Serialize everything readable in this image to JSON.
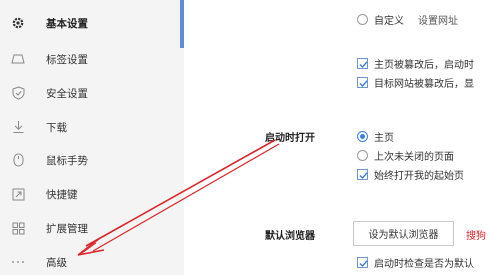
{
  "sidebar": {
    "items": [
      {
        "label": "基本设置",
        "icon": "gear-icon",
        "active": true
      },
      {
        "label": "标签设置",
        "icon": "tab-icon"
      },
      {
        "label": "安全设置",
        "icon": "shield-icon"
      },
      {
        "label": "下载",
        "icon": "download-icon"
      },
      {
        "label": "鼠标手势",
        "icon": "mouse-icon"
      },
      {
        "label": "快捷键",
        "icon": "shortcut-icon"
      },
      {
        "label": "扩展管理",
        "icon": "extensions-icon"
      },
      {
        "label": "高级",
        "icon": "more-icon"
      }
    ]
  },
  "homepage": {
    "custom_label": "自定义",
    "set_url_label": "设置网址",
    "tamper_startup_label": "主页被篡改后，启动时",
    "tamper_site_label": "目标网站被篡改后，显"
  },
  "startup": {
    "section_label": "启动时打开",
    "options": [
      "主页",
      "上次未关闭的页面"
    ],
    "selected_option": "主页",
    "always_open_label": "始终打开我的起始页"
  },
  "default_browser": {
    "section_label": "默认浏览器",
    "set_default_button": "设为默认浏览器",
    "red_text": "搜狗",
    "check_on_start_label": "启动时检查是否为默认"
  },
  "colors": {
    "accent": "#3c7ee8",
    "annotation_arrow": "#d9252b",
    "sidebar_bg": "#f4f4f4"
  }
}
